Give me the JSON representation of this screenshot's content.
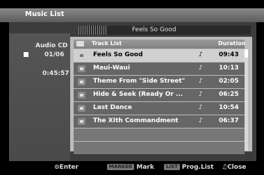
{
  "window": {
    "title": "Music List"
  },
  "left_panel": {
    "disc": "Audio CD",
    "track_position": "01/06",
    "elapsed": "0:45:57"
  },
  "now_playing": {
    "title": "Feels So Good"
  },
  "list": {
    "columns": {
      "track": "Track List",
      "duration": "Duration"
    },
    "rows": [
      {
        "name": "Feels So Good",
        "note": "♪",
        "duration": "09:43",
        "selected": true
      },
      {
        "name": "Maui-Waui",
        "note": "♪",
        "duration": "10:13"
      },
      {
        "name": "Theme From \"Side Street\"",
        "note": "♪",
        "duration": "02:05"
      },
      {
        "name": "Hide & Seek (Ready Or ...",
        "note": "♪",
        "duration": "06:25"
      },
      {
        "name": "Last Dance",
        "note": "♪",
        "duration": "10:54"
      },
      {
        "name": "The XIth Commandment",
        "note": "♪",
        "duration": "06:37"
      }
    ]
  },
  "footer": {
    "enter_icon": "⊙",
    "enter_label": "Enter",
    "marker_badge": "MARKER",
    "marker_label": "Mark",
    "list_badge": "LIST",
    "list_label": "Prog.List",
    "close_icon": "♫",
    "close_label": "Close"
  }
}
